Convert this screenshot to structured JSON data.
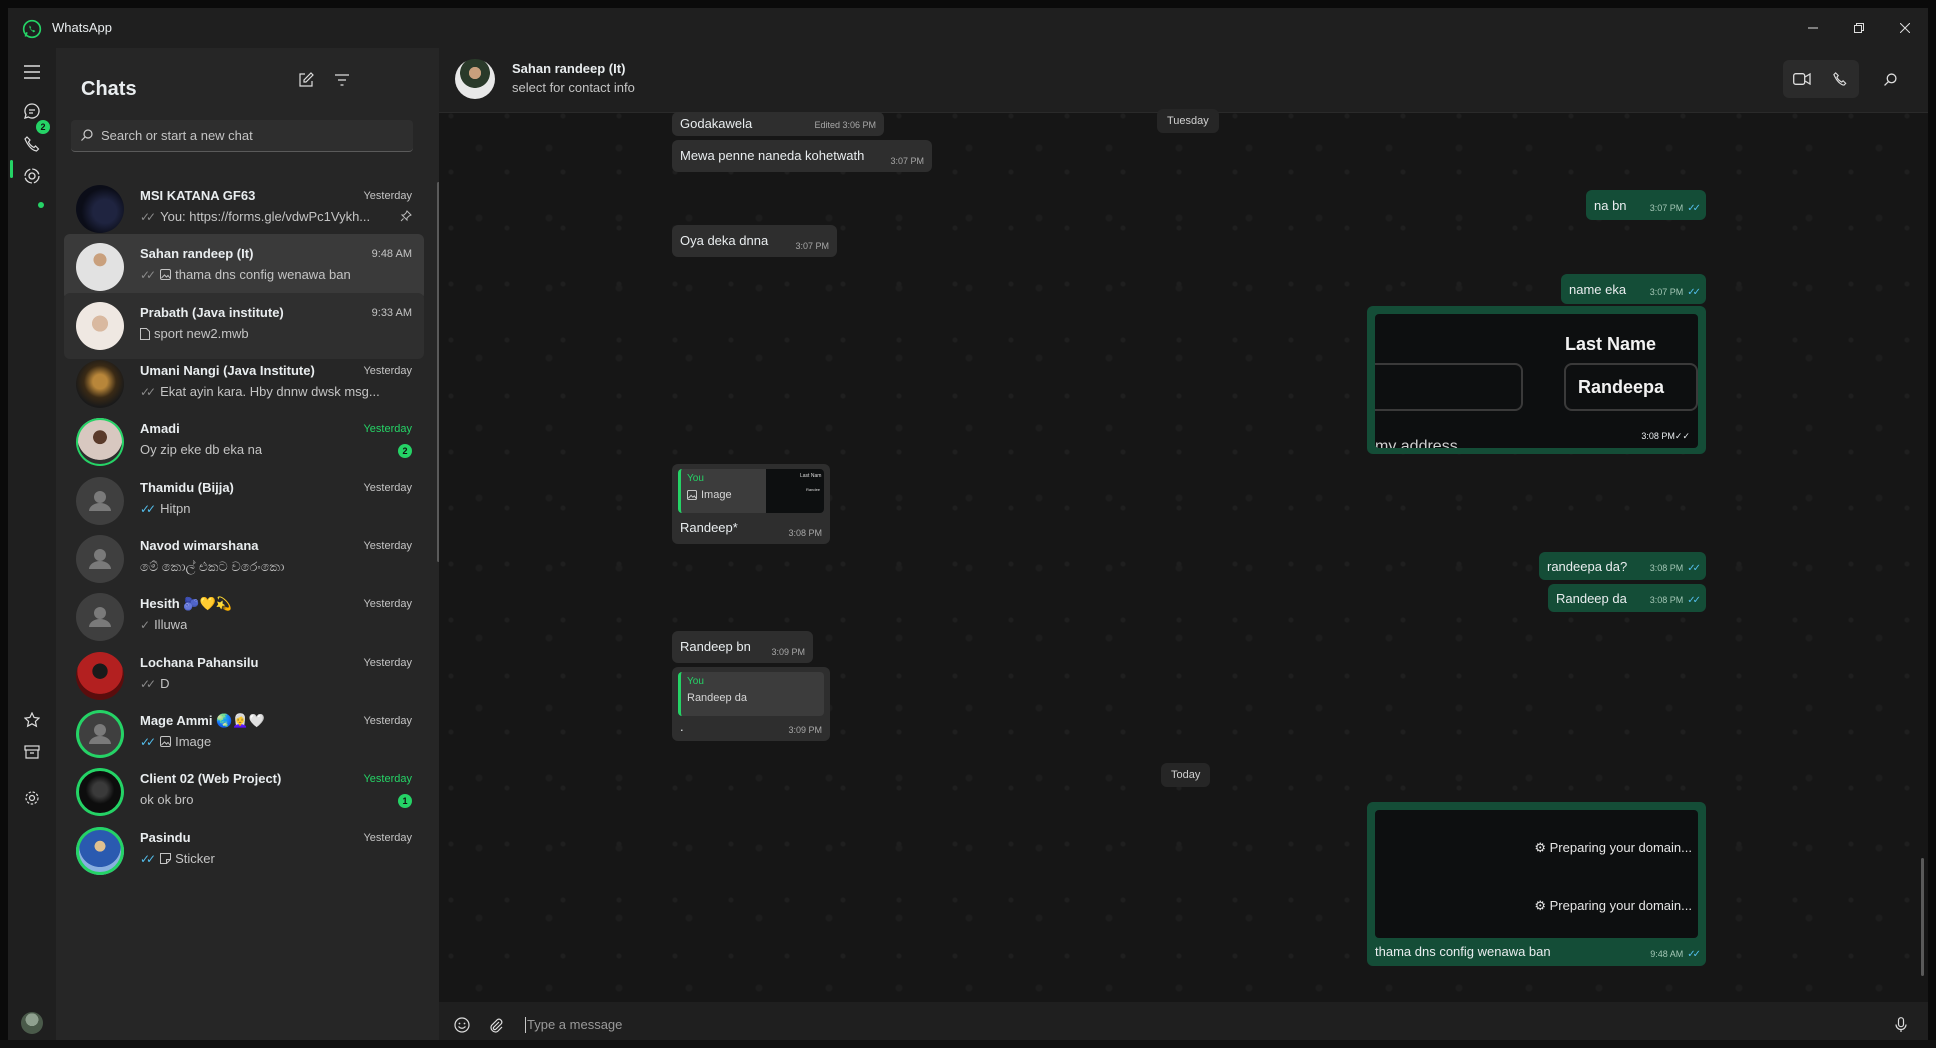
{
  "app": {
    "title": "WhatsApp"
  },
  "rail": {
    "chats_badge": "2"
  },
  "chat_list": {
    "title": "Chats",
    "search_placeholder": "Search or start a new chat",
    "chats": [
      {
        "name": "MSI KATANA GF63",
        "time": "Yesterday",
        "tick": "double-grey",
        "preview": "You: https://forms.gle/vdwPc1Vykh...",
        "pinned": true
      },
      {
        "name": "Sahan randeep (It)",
        "time": "9:48 AM",
        "tick": "double-grey",
        "media": "image-icon",
        "preview": "thama dns config wenawa ban",
        "active": true
      },
      {
        "name": "Prabath (Java institute)",
        "time": "9:33 AM",
        "media": "document-icon",
        "preview": "sport new2.mwb"
      },
      {
        "name": "Umani Nangi (Java Institute)",
        "time": "Yesterday",
        "tick": "double-grey",
        "preview": "Ekat ayin kara. Hby dnnw dwsk msg..."
      },
      {
        "name": "Amadi",
        "time": "Yesterday",
        "preview": "Oy zip eke db eka na",
        "unread": "2"
      },
      {
        "name": "Thamidu (Bijja)",
        "time": "Yesterday",
        "tick": "double-blue",
        "preview": "Hitpn"
      },
      {
        "name": "Navod wimarshana",
        "time": "Yesterday",
        "preview": "මේ කොල් එකට වරෙංකො"
      },
      {
        "name": "Hesith 🫐💛💫",
        "time": "Yesterday",
        "tick": "single-grey",
        "preview": "Illuwa"
      },
      {
        "name": "Lochana Pahansilu",
        "time": "Yesterday",
        "tick": "double-grey",
        "preview": "D"
      },
      {
        "name": "Mage Ammi 🌏👩‍🦳🤍",
        "time": "Yesterday",
        "tick": "double-blue",
        "media": "image-icon",
        "preview": "Image"
      },
      {
        "name": "Client 02 (Web Project)",
        "time": "Yesterday",
        "preview": "ok ok bro",
        "unread": "1"
      },
      {
        "name": "Pasindu",
        "time": "Yesterday",
        "tick": "double-blue",
        "media": "sticker-icon",
        "preview": "Sticker"
      }
    ]
  },
  "conversation": {
    "contact_name": "Sahan randeep (It)",
    "contact_subtitle": "select for contact info",
    "day_chips": {
      "tuesday": "Tuesday",
      "today": "Today"
    },
    "messages": {
      "m1": {
        "text": "Godakawela",
        "meta": "Edited 3:06 PM"
      },
      "m2": {
        "text": "Mewa penne naneda kohetwath",
        "time": "3:07 PM"
      },
      "m3": {
        "text": "na bn",
        "time": "3:07 PM"
      },
      "m4": {
        "text": "Oya deka dnna",
        "time": "3:07 PM"
      },
      "m5": {
        "text": "name eka",
        "time": "3:07 PM"
      },
      "m6": {
        "img_label": "Last Name",
        "img_value": "Randeepa",
        "img_footer": "my address",
        "time": "3:08 PM"
      },
      "m7": {
        "quote_who": "You",
        "quote_text": "Image",
        "quote_thumb1": "Last Nam",
        "quote_thumb2": "Randee",
        "text": "Randeep*",
        "time": "3:08 PM"
      },
      "m8": {
        "text": "randeepa da?",
        "time": "3:08 PM"
      },
      "m9": {
        "text": "Randeep da",
        "time": "3:08 PM"
      },
      "m10": {
        "text": "Randeep bn",
        "time": "3:09 PM"
      },
      "m11": {
        "quote_who": "You",
        "quote_text": "Randeep da",
        "text": ".",
        "time": "3:09 PM"
      },
      "m12": {
        "img_line1": "Preparing your domain...",
        "img_line2": "Preparing your domain...",
        "text": "thama dns config wenawa ban",
        "time": "9:48 AM"
      }
    },
    "composer_placeholder": "Type a message"
  }
}
